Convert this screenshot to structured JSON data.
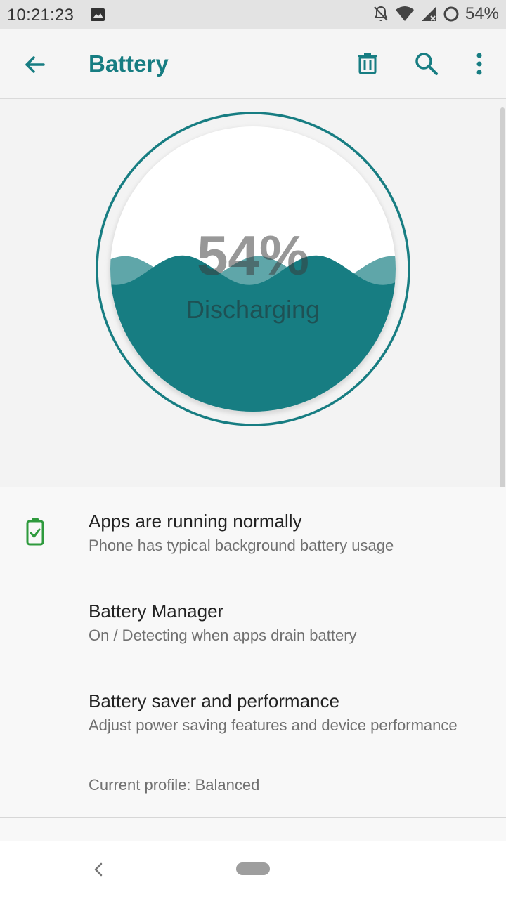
{
  "status_bar": {
    "time": "10:21:23",
    "battery_percent": "54%",
    "icons": [
      "image-icon",
      "notifications-off-icon",
      "wifi-icon",
      "signal-icon",
      "battery-saver-icon"
    ]
  },
  "app_bar": {
    "title": "Battery",
    "actions": [
      "back-arrow-icon",
      "delete-icon",
      "search-icon",
      "more-vert-icon"
    ]
  },
  "battery": {
    "level_percent": 54,
    "level_label": "54%",
    "state": "Discharging"
  },
  "list": [
    {
      "title": "Apps are running normally",
      "subtitle": "Phone has typical background battery usage",
      "icon": "battery-check-icon",
      "icon_color": "#2e9a3d"
    },
    {
      "title": "Battery Manager",
      "subtitle": "On / Detecting when apps drain battery"
    },
    {
      "title": "Battery saver and performance",
      "subtitle": "Adjust power saving features and device performance",
      "extra": "Current profile: Balanced"
    }
  ],
  "colors": {
    "accent": "#177d82",
    "wave_front": "#177d82",
    "wave_back": "#5fa6a9"
  },
  "nav_bar": {
    "icons": [
      "nav-back-icon",
      "nav-home-pill"
    ]
  }
}
